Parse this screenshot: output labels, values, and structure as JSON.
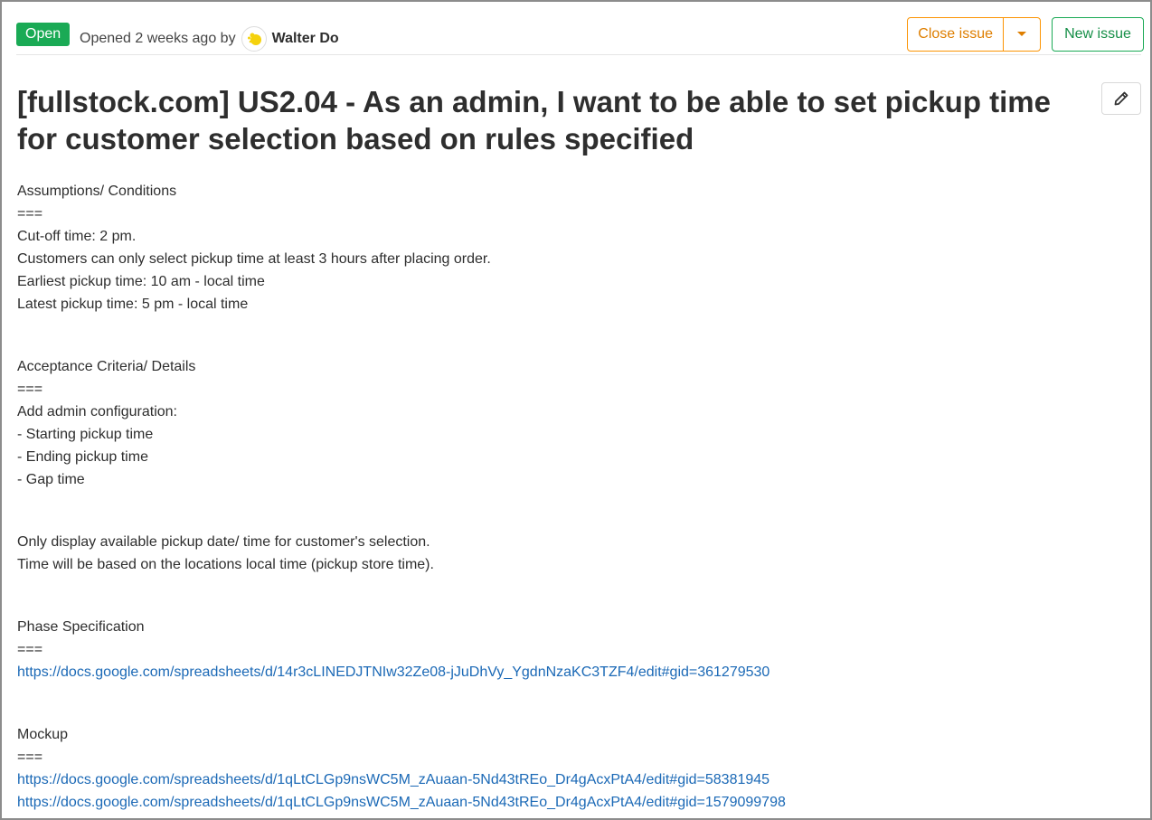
{
  "header": {
    "status": "Open",
    "opened_text": "Opened 2 weeks ago by",
    "author": "Walter Do",
    "close_label": "Close issue",
    "new_issue_label": "New issue"
  },
  "issue": {
    "title": "[fullstock.com] US2.04 - As an admin, I want to be able to set pickup time for customer selection based on rules specified"
  },
  "description": {
    "assumptions": {
      "heading": "Assumptions/ Conditions",
      "sep": "===",
      "lines": [
        "Cut-off time: 2 pm.",
        "Customers can only select pickup time at least 3 hours after placing order.",
        "Earliest pickup time: 10 am - local time",
        "Latest pickup time: 5 pm - local time"
      ]
    },
    "acceptance": {
      "heading": "Acceptance Criteria/ Details",
      "sep": "===",
      "lines": [
        "Add admin configuration:",
        "- Starting pickup time",
        "- Ending pickup time",
        "- Gap time"
      ]
    },
    "display": {
      "lines": [
        "Only display available pickup date/ time for customer's selection.",
        "Time will be based on the locations local time (pickup store time)."
      ]
    },
    "phase": {
      "heading": "Phase Specification",
      "sep": "===",
      "link": "https://docs.google.com/spreadsheets/d/14r3cLINEDJTNIw32Ze08-jJuDhVy_YgdnNzaKC3TZF4/edit#gid=361279530"
    },
    "mockup": {
      "heading": "Mockup",
      "sep": "===",
      "links": [
        "https://docs.google.com/spreadsheets/d/1qLtCLGp9nsWC5M_zAuaan-5Nd43tREo_Dr4gAcxPtA4/edit#gid=58381945",
        "https://docs.google.com/spreadsheets/d/1qLtCLGp9nsWC5M_zAuaan-5Nd43tREo_Dr4gAcxPtA4/edit#gid=1579099798"
      ]
    }
  },
  "colors": {
    "open_badge": "#1aaa55",
    "close_accent": "#fc9403",
    "new_issue_accent": "#1aaa55",
    "link": "#1b69b6"
  },
  "icons": {
    "author_avatar": "avatar",
    "close_dropdown": "caret-down-icon",
    "edit": "pencil-icon"
  }
}
